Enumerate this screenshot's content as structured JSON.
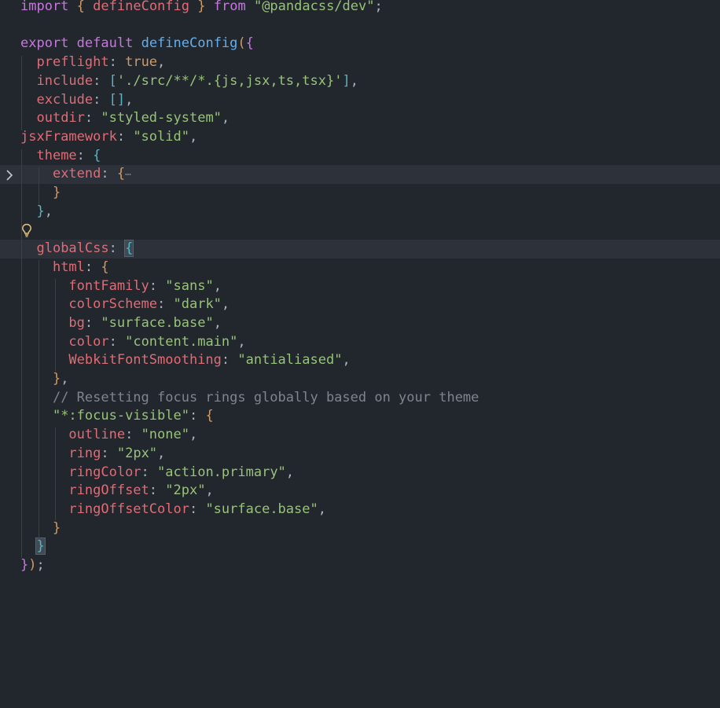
{
  "editor": {
    "language": "typescript",
    "theme_colors": {
      "background": "#22262d",
      "keyword": "#c678dd",
      "function": "#61afef",
      "property": "#e06c75",
      "string": "#98c379",
      "comment": "#7f848e"
    },
    "fold_icon": "chevron-right-icon",
    "lightbulb_icon": "lightbulb-icon",
    "folded_placeholder": "⋯",
    "lines": [
      {
        "tokens": [
          [
            "t-kw",
            "import"
          ],
          [
            "t-pl",
            " "
          ],
          [
            "t-b1",
            "{"
          ],
          [
            "t-pl",
            " "
          ],
          [
            "t-id",
            "defineConfig"
          ],
          [
            "t-pl",
            " "
          ],
          [
            "t-b1",
            "}"
          ],
          [
            "t-pl",
            " "
          ],
          [
            "t-kw",
            "from"
          ],
          [
            "t-pl",
            " "
          ],
          [
            "t-str",
            "\"@pandacss/dev\""
          ],
          [
            "t-pl",
            ";"
          ]
        ]
      },
      {
        "tokens": []
      },
      {
        "tokens": [
          [
            "t-kw",
            "export"
          ],
          [
            "t-pl",
            " "
          ],
          [
            "t-kw",
            "default"
          ],
          [
            "t-pl",
            " "
          ],
          [
            "t-fn",
            "defineConfig"
          ],
          [
            "t-b1",
            "("
          ],
          [
            "t-b2",
            "{"
          ]
        ]
      },
      {
        "tokens": [
          [
            "t-pl",
            "  "
          ],
          [
            "t-id",
            "preflight"
          ],
          [
            "t-pl",
            ": "
          ],
          [
            "t-num",
            "true"
          ],
          [
            "t-pl",
            ","
          ]
        ]
      },
      {
        "tokens": [
          [
            "t-pl",
            "  "
          ],
          [
            "t-id",
            "include"
          ],
          [
            "t-pl",
            ": "
          ],
          [
            "t-b3",
            "["
          ],
          [
            "t-str",
            "'./src/**/*.{js,jsx,ts,tsx}'"
          ],
          [
            "t-b3",
            "]"
          ],
          [
            "t-pl",
            ","
          ]
        ]
      },
      {
        "tokens": [
          [
            "t-pl",
            "  "
          ],
          [
            "t-id",
            "exclude"
          ],
          [
            "t-pl",
            ": "
          ],
          [
            "t-b3",
            "[]"
          ],
          [
            "t-pl",
            ","
          ]
        ]
      },
      {
        "tokens": [
          [
            "t-pl",
            "  "
          ],
          [
            "t-id",
            "outdir"
          ],
          [
            "t-pl",
            ": "
          ],
          [
            "t-str",
            "\"styled-system\""
          ],
          [
            "t-pl",
            ","
          ]
        ]
      },
      {
        "tokens": [
          [
            "t-id",
            "jsxFramework"
          ],
          [
            "t-pl",
            ": "
          ],
          [
            "t-str",
            "\"solid\""
          ],
          [
            "t-pl",
            ","
          ]
        ]
      },
      {
        "tokens": [
          [
            "t-pl",
            "  "
          ],
          [
            "t-id",
            "theme"
          ],
          [
            "t-pl",
            ": "
          ],
          [
            "t-b3",
            "{"
          ]
        ]
      },
      {
        "tokens": [
          [
            "t-pl",
            "    "
          ],
          [
            "t-id",
            "extend"
          ],
          [
            "t-pl",
            ": "
          ],
          [
            "t-b1",
            "{"
          ]
        ],
        "folded": true,
        "highlight": true
      },
      {
        "tokens": [
          [
            "t-pl",
            "    "
          ],
          [
            "t-b1",
            "}"
          ]
        ]
      },
      {
        "tokens": [
          [
            "t-pl",
            "  "
          ],
          [
            "t-b3",
            "}"
          ],
          [
            "t-pl",
            ","
          ]
        ]
      },
      {
        "tokens": []
      },
      {
        "tokens": [
          [
            "t-pl",
            "  "
          ],
          [
            "t-id",
            "globalCss"
          ],
          [
            "t-pl",
            ": "
          ],
          [
            "t-b3 t-mk",
            "{"
          ]
        ],
        "highlight": true
      },
      {
        "tokens": [
          [
            "t-pl",
            "    "
          ],
          [
            "t-id",
            "html"
          ],
          [
            "t-pl",
            ": "
          ],
          [
            "t-b1",
            "{"
          ]
        ]
      },
      {
        "tokens": [
          [
            "t-pl",
            "      "
          ],
          [
            "t-id",
            "fontFamily"
          ],
          [
            "t-pl",
            ": "
          ],
          [
            "t-str",
            "\"sans\""
          ],
          [
            "t-pl",
            ","
          ]
        ]
      },
      {
        "tokens": [
          [
            "t-pl",
            "      "
          ],
          [
            "t-id",
            "colorScheme"
          ],
          [
            "t-pl",
            ": "
          ],
          [
            "t-str",
            "\"dark\""
          ],
          [
            "t-pl",
            ","
          ]
        ]
      },
      {
        "tokens": [
          [
            "t-pl",
            "      "
          ],
          [
            "t-id",
            "bg"
          ],
          [
            "t-pl",
            ": "
          ],
          [
            "t-str",
            "\"surface.base\""
          ],
          [
            "t-pl",
            ","
          ]
        ]
      },
      {
        "tokens": [
          [
            "t-pl",
            "      "
          ],
          [
            "t-id",
            "color"
          ],
          [
            "t-pl",
            ": "
          ],
          [
            "t-str",
            "\"content.main\""
          ],
          [
            "t-pl",
            ","
          ]
        ]
      },
      {
        "tokens": [
          [
            "t-pl",
            "      "
          ],
          [
            "t-id",
            "WebkitFontSmoothing"
          ],
          [
            "t-pl",
            ": "
          ],
          [
            "t-str",
            "\"antialiased\""
          ],
          [
            "t-pl",
            ","
          ]
        ]
      },
      {
        "tokens": [
          [
            "t-pl",
            "    "
          ],
          [
            "t-b1",
            "}"
          ],
          [
            "t-pl",
            ","
          ]
        ]
      },
      {
        "tokens": [
          [
            "t-pl",
            "    "
          ],
          [
            "t-cm",
            "// Resetting focus rings globally based on your theme"
          ]
        ]
      },
      {
        "tokens": [
          [
            "t-pl",
            "    "
          ],
          [
            "t-str",
            "\"*:focus-visible\""
          ],
          [
            "t-pl",
            ": "
          ],
          [
            "t-b1",
            "{"
          ]
        ]
      },
      {
        "tokens": [
          [
            "t-pl",
            "      "
          ],
          [
            "t-id",
            "outline"
          ],
          [
            "t-pl",
            ": "
          ],
          [
            "t-str",
            "\"none\""
          ],
          [
            "t-pl",
            ","
          ]
        ]
      },
      {
        "tokens": [
          [
            "t-pl",
            "      "
          ],
          [
            "t-id",
            "ring"
          ],
          [
            "t-pl",
            ": "
          ],
          [
            "t-str",
            "\"2px\""
          ],
          [
            "t-pl",
            ","
          ]
        ]
      },
      {
        "tokens": [
          [
            "t-pl",
            "      "
          ],
          [
            "t-id",
            "ringColor"
          ],
          [
            "t-pl",
            ": "
          ],
          [
            "t-str",
            "\"action.primary\""
          ],
          [
            "t-pl",
            ","
          ]
        ]
      },
      {
        "tokens": [
          [
            "t-pl",
            "      "
          ],
          [
            "t-id",
            "ringOffset"
          ],
          [
            "t-pl",
            ": "
          ],
          [
            "t-str",
            "\"2px\""
          ],
          [
            "t-pl",
            ","
          ]
        ]
      },
      {
        "tokens": [
          [
            "t-pl",
            "      "
          ],
          [
            "t-id",
            "ringOffsetColor"
          ],
          [
            "t-pl",
            ": "
          ],
          [
            "t-str",
            "\"surface.base\""
          ],
          [
            "t-pl",
            ","
          ]
        ]
      },
      {
        "tokens": [
          [
            "t-pl",
            "    "
          ],
          [
            "t-b1",
            "}"
          ]
        ]
      },
      {
        "tokens": [
          [
            "t-pl",
            "  "
          ],
          [
            "t-b3 t-mk",
            "}"
          ]
        ]
      },
      {
        "tokens": [
          [
            "t-b2",
            "}"
          ],
          [
            "t-b1",
            ")"
          ],
          [
            "t-pl",
            ";"
          ]
        ]
      }
    ]
  }
}
